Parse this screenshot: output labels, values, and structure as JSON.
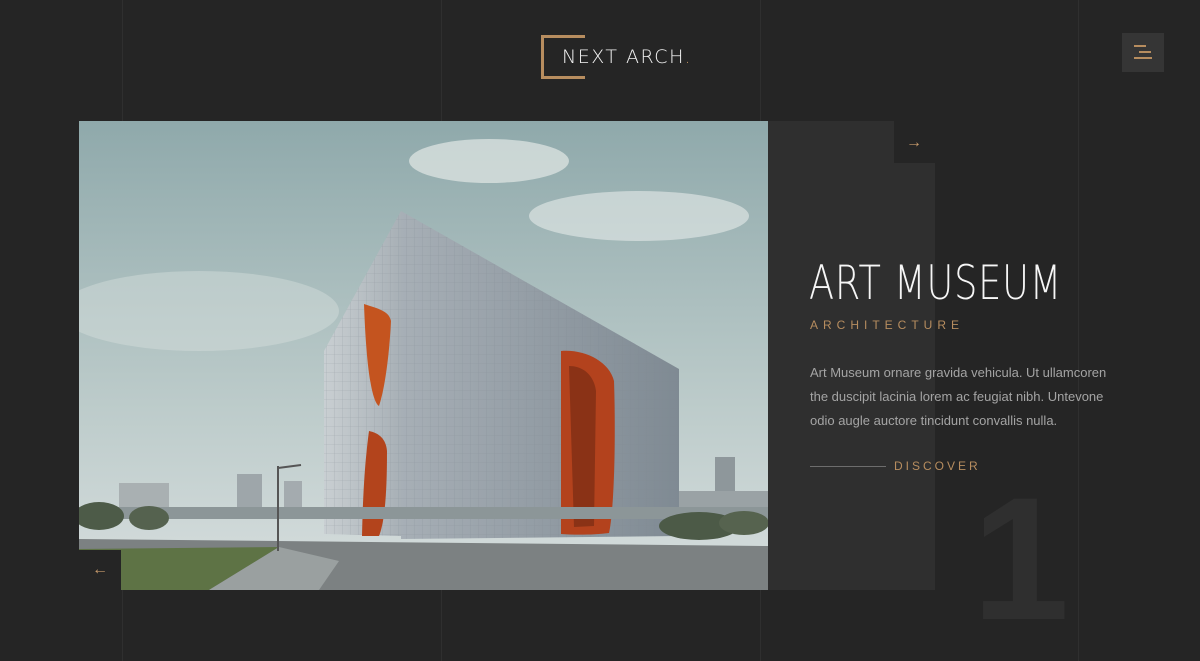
{
  "brand": {
    "name": "NEXT ARCH",
    "dot": "."
  },
  "slide": {
    "title": "ART MUSEUM",
    "category": "ARCHITECTURE",
    "description": "Art  Museum ornare gravida vehicula. Ut ullamcoren the duscipit lacinia lorem ac feugiat nibh. Untevone odio augle auctore tincidunt convallis nulla.",
    "cta": "DISCOVER",
    "number": "1"
  },
  "nav": {
    "next_arrow": "→",
    "prev_arrow": "←"
  },
  "icons": {
    "menu": "menu-icon",
    "next": "arrow-right-icon",
    "prev": "arrow-left-icon",
    "logo": "logo-frame-icon"
  },
  "colors": {
    "background": "#252525",
    "panel": "#2f2f2f",
    "accent": "#b78d5f",
    "text": "#f6f6f6",
    "muted": "#a4a4a4"
  }
}
